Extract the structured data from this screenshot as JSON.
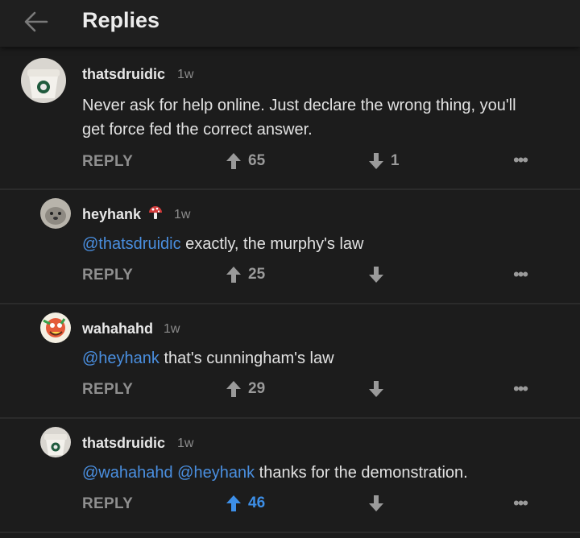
{
  "header": {
    "title": "Replies",
    "back_icon": "arrow-left-icon"
  },
  "comments": [
    {
      "username": "thatsdruidic",
      "time": "1w",
      "mentions": [],
      "text_lines": [
        "Never ask for help online. Just declare the wrong thing, you'll",
        "get force fed the correct answer."
      ],
      "reply_label": "REPLY",
      "upvotes": "65",
      "downvotes": "1",
      "upvoted": false
    },
    {
      "username": "heyhank",
      "flair_icon": "mushroom-icon",
      "time": "1w",
      "mentions": [
        "@thatsdruidic"
      ],
      "text": "exactly, the murphy's law",
      "reply_label": "REPLY",
      "upvotes": "25",
      "downvotes": "",
      "upvoted": false
    },
    {
      "username": "wahahahd",
      "time": "1w",
      "mentions": [
        "@heyhank"
      ],
      "text": "that's cunningham's law",
      "reply_label": "REPLY",
      "upvotes": "29",
      "downvotes": "",
      "upvoted": false
    },
    {
      "username": "thatsdruidic",
      "time": "1w",
      "mentions": [
        "@wahahahd",
        "@heyhank"
      ],
      "text": "thanks for the demonstration.",
      "reply_label": "REPLY",
      "upvotes": "46",
      "downvotes": "",
      "upvoted": true
    }
  ],
  "colors": {
    "accent": "#3d8fe8",
    "mention": "#4a8fe0",
    "background": "#1c1c1c"
  }
}
